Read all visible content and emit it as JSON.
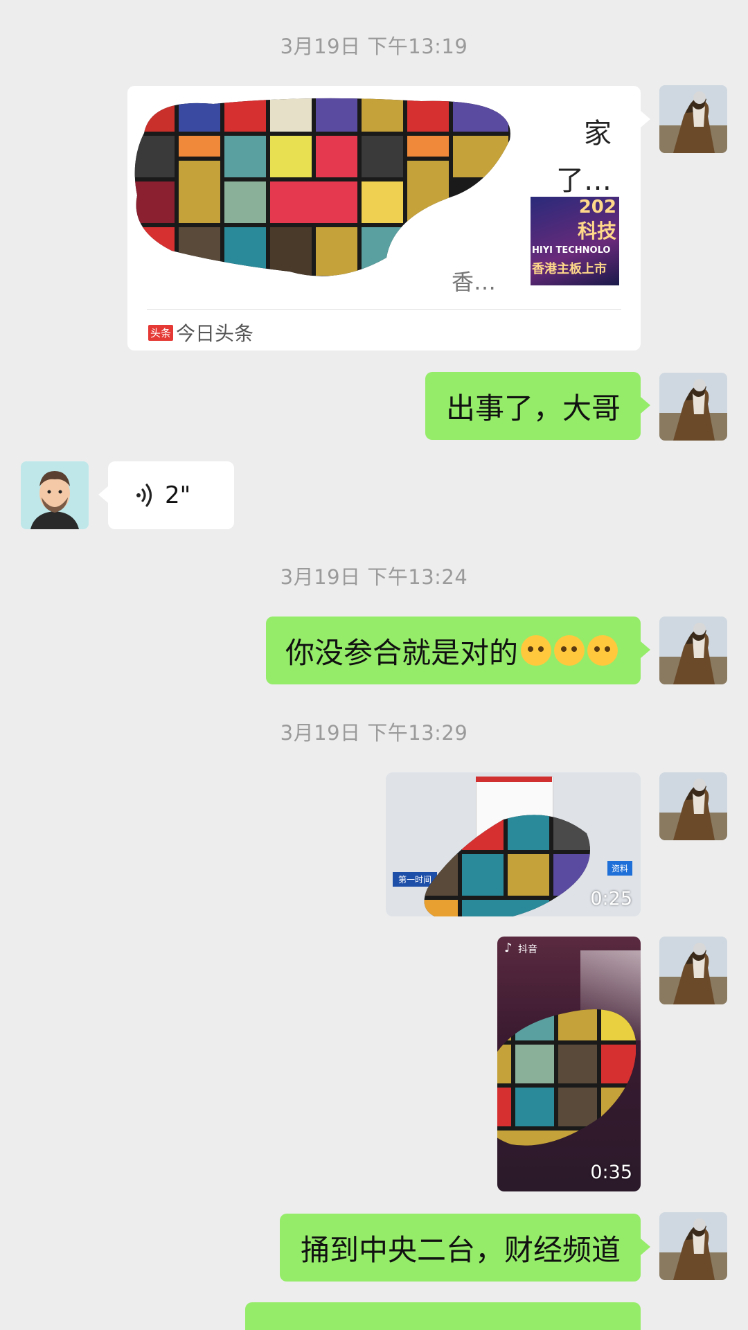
{
  "timestamps": [
    "3月19日 下午13:19",
    "3月19日 下午13:24",
    "3月19日 下午13:29"
  ],
  "link_card": {
    "source": "今日头条",
    "source_badge": "头条",
    "title_fragment_1": "家",
    "title_fragment_2": "了…",
    "desc_fragment": "香…",
    "thumb_text_1": "202",
    "thumb_text_2": "科技",
    "thumb_text_3": "HIYI TECHNOLO",
    "thumb_text_4": "香港主板上市"
  },
  "messages": {
    "msg1": "出事了，大哥",
    "voice_duration": "2\"",
    "msg2": "你没参合就是对的",
    "msg3": "捅到中央二台，财经频道"
  },
  "videos": {
    "video1_duration": "0:25",
    "video1_badge": "资料",
    "video1_tag": "第一时间",
    "video2_duration": "0:35",
    "video2_app": "抖音"
  },
  "colors": {
    "background": "#ededed",
    "sent_bubble": "#95ec69",
    "received_bubble": "#ffffff",
    "timestamp_text": "#9a9a9a"
  },
  "icons": {
    "voice": "voice-wave-icon",
    "toutiao": "toutiao-logo-icon",
    "emoji": "smirk-emoji-icon",
    "douyin": "douyin-logo-icon"
  }
}
